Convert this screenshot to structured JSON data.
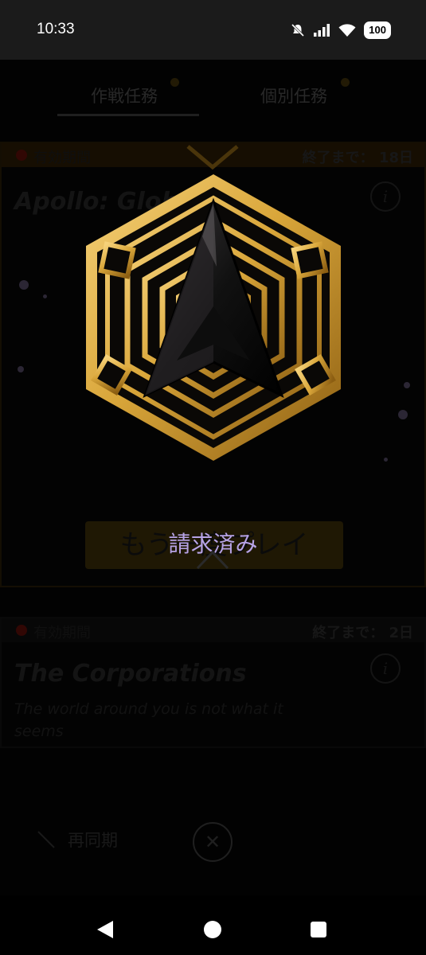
{
  "status_bar": {
    "time": "10:33",
    "battery": "100"
  },
  "tabs": [
    {
      "label": "作戦任務"
    },
    {
      "label": "個別任務"
    }
  ],
  "missions": [
    {
      "validity_label": "有効期間",
      "remaining": "終了まで：  18日",
      "title": "Apollo: Globa",
      "play_again_label": "もう一度プレイ"
    },
    {
      "validity_label": "有効期間",
      "remaining": "終了まで：  2日",
      "title": "The Corporations",
      "subtitle": "The world around you is not what it seems"
    }
  ],
  "bottom": {
    "resync_label": "再同期"
  },
  "overlay": {
    "claimed_label": "請求済み"
  },
  "colors": {
    "gold": "#d9a63a",
    "claimed_text": "#b7a3e6",
    "background": "#000000"
  },
  "icons": {
    "mute": "bell-off-icon",
    "signal": "signal-icon",
    "wifi": "wifi-icon",
    "info": "info-icon",
    "close": "close-icon",
    "resync": "sync-icon",
    "badge": "hexagon-arrow-badge-icon"
  }
}
